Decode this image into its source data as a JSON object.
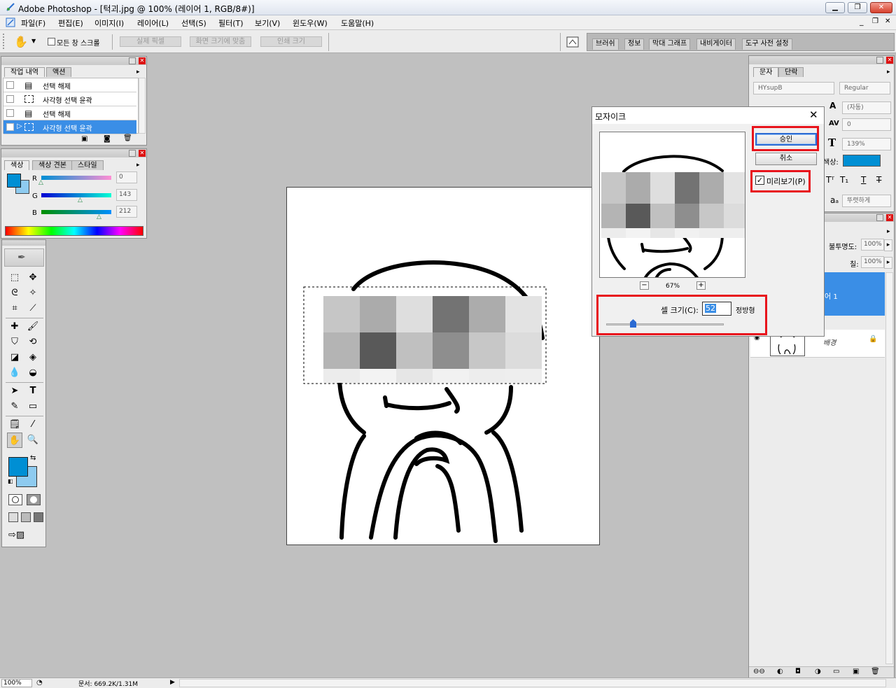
{
  "window": {
    "title": "Adobe Photoshop - [턱괴.jpg @ 100% (레이어 1, RGB/8#)]",
    "minimize_icon": "▁",
    "restore_icon": "❐",
    "close_icon": "✕"
  },
  "menu": [
    "파일(F)",
    "편집(E)",
    "이미지(I)",
    "레이어(L)",
    "선택(S)",
    "필터(T)",
    "보기(V)",
    "윈도우(W)",
    "도움말(H)"
  ],
  "doc_window_controls": [
    "_",
    "❐",
    "✕"
  ],
  "options_bar": {
    "hand_tool_icon": "hand-icon",
    "scroll_all_windows_label": "모든 창 스크롤",
    "actual_pixels_label": "실제 픽셀",
    "fit_screen_label": "화면 크기에 맞춤",
    "print_size_label": "인쇄 크기",
    "well_tabs": [
      "브러쉬",
      "정보",
      "막대 그래프",
      "내비게이터",
      "도구 사전 설정"
    ]
  },
  "history_panel": {
    "tabs": [
      "작업 내역",
      "액션"
    ],
    "items": [
      {
        "label": "선택 해제",
        "selected": false
      },
      {
        "label": "사각형 선택 윤곽",
        "selected": false
      },
      {
        "label": "선택 해제",
        "selected": false
      },
      {
        "label": "사각형 선택 윤곽",
        "selected": true
      }
    ]
  },
  "color_panel": {
    "tabs": [
      "색상",
      "색상 견본",
      "스타일"
    ],
    "foreground": "#008fd4",
    "background": "#8ecbf0",
    "channels": [
      {
        "label": "R",
        "value": "0",
        "fraction": 0.0
      },
      {
        "label": "G",
        "value": "143",
        "fraction": 0.56
      },
      {
        "label": "B",
        "value": "212",
        "fraction": 0.83
      }
    ]
  },
  "character_panel": {
    "tabs": [
      "문자",
      "단락"
    ],
    "font_family": "HYsupB",
    "font_style": "Regular",
    "leading": "(자동)",
    "tracking": "0",
    "scale": "139%",
    "color_label": "색상:",
    "color": "#008fd4",
    "antialias": "뚜렷하게"
  },
  "layers_panel": {
    "opacity_label": "불투명도:",
    "opacity": "100%",
    "fill_label": "칠:",
    "fill": "100%",
    "layer1_name": "어 1",
    "background_name": "배경"
  },
  "mosaic_dialog": {
    "title": "모자이크",
    "ok_label": "승인",
    "cancel_label": "취소",
    "preview_label": "미리보기(P)",
    "preview_checked": true,
    "zoom": "67%",
    "zoom_out": "−",
    "zoom_in": "+",
    "cell_size_label": "셀 크기(C):",
    "cell_size_value": "52",
    "cell_unit": "정방형",
    "cell_size_slider_fraction": 0.2
  },
  "status_bar": {
    "zoom": "100%",
    "doc_info": "문서: 669.2K/1.31M"
  }
}
